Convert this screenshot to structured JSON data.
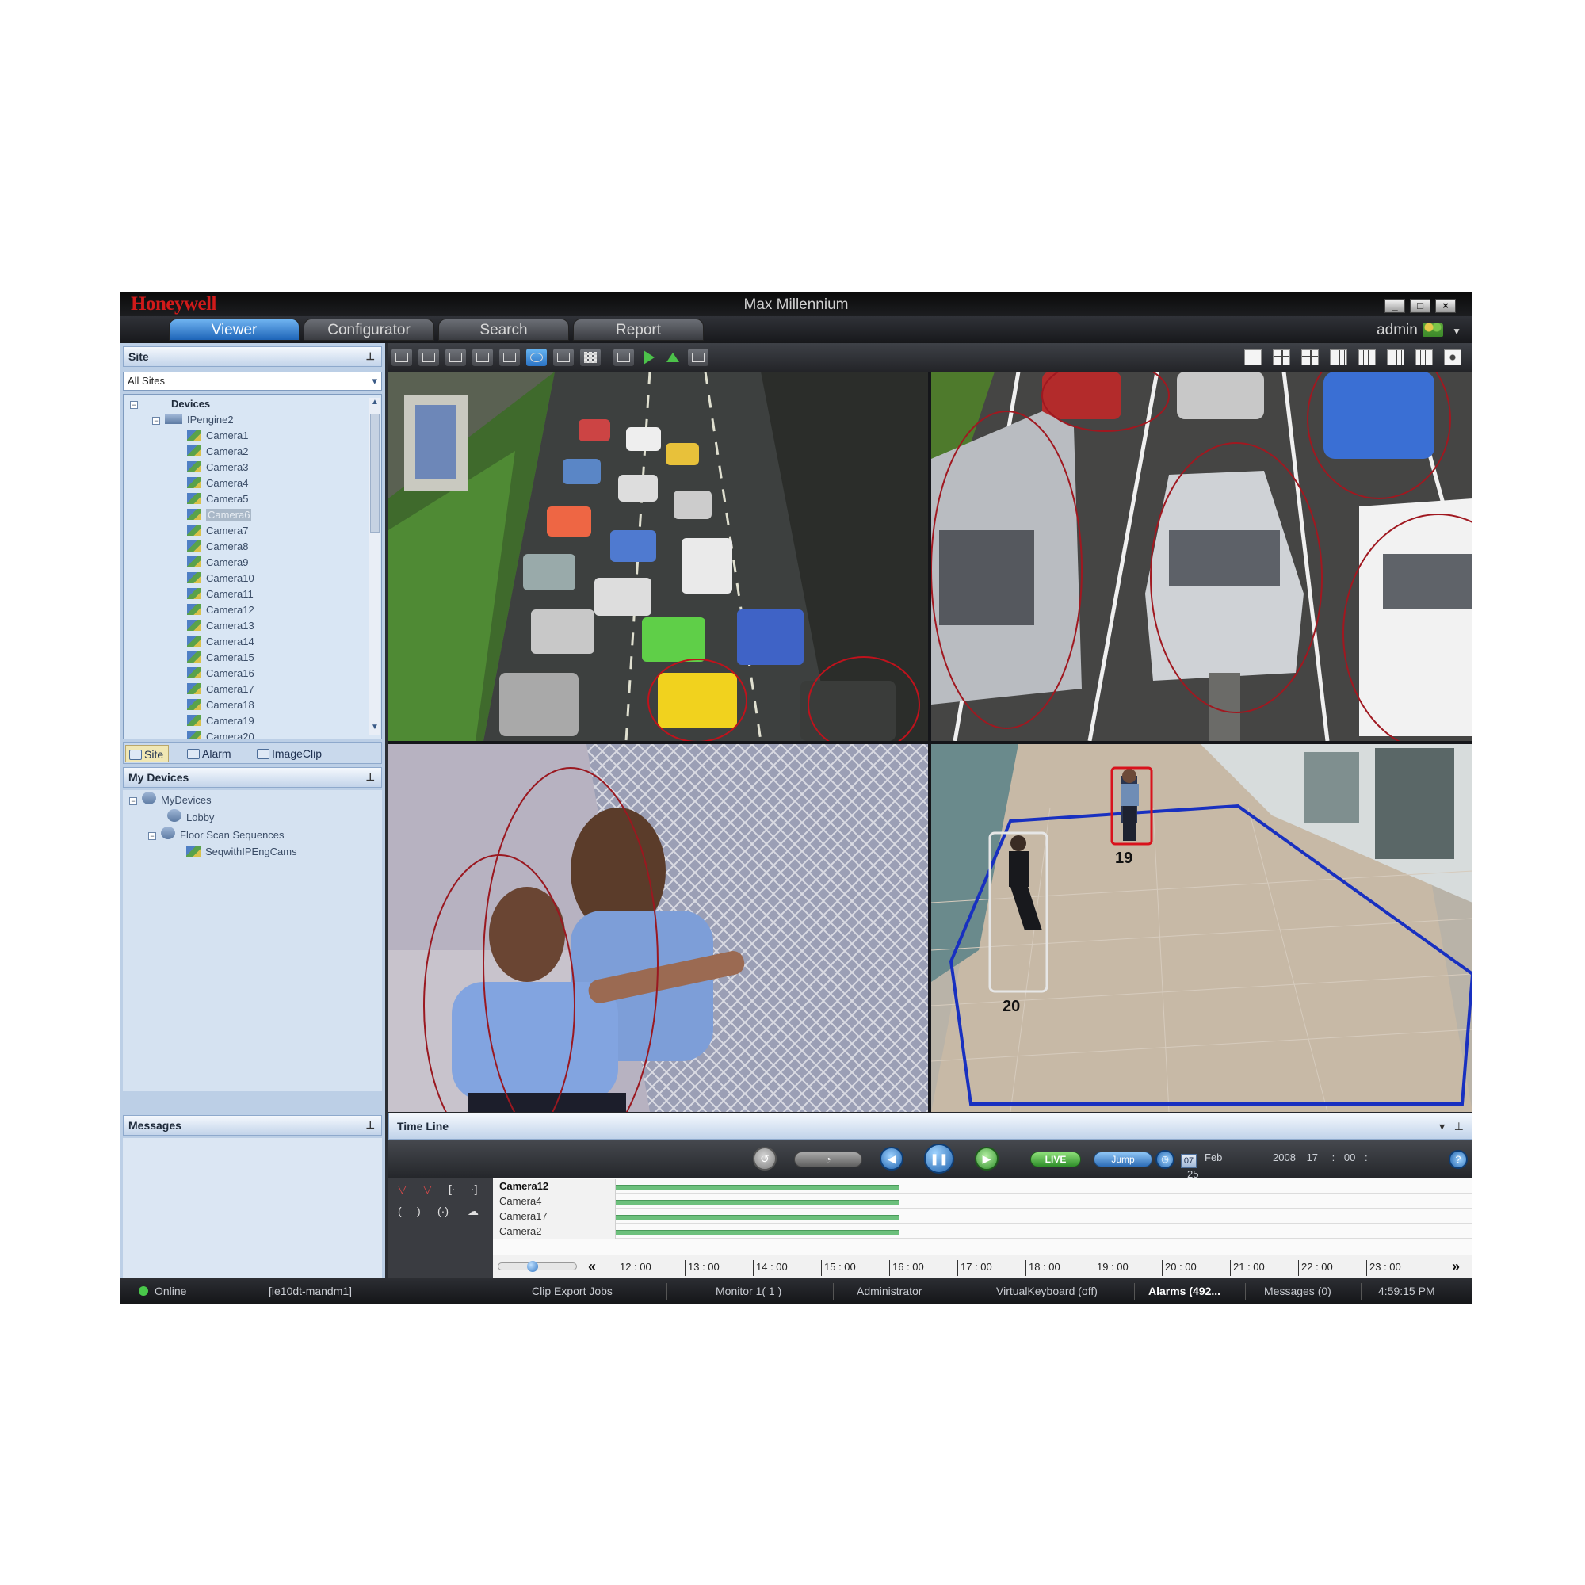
{
  "window": {
    "brand": "Honeywell",
    "title": "Max Millennium",
    "controls": [
      "minimize-icon",
      "maximize-icon",
      "close-icon"
    ]
  },
  "tabs": [
    {
      "label": "Viewer",
      "active": true
    },
    {
      "label": "Configurator",
      "active": false
    },
    {
      "label": "Search",
      "active": false
    },
    {
      "label": "Report",
      "active": false
    }
  ],
  "user": {
    "name": "admin",
    "icon": "users-icon"
  },
  "site_panel": {
    "title": "Site",
    "combo_value": "All Sites",
    "tree": {
      "root": "Devices",
      "server": "IPengine2",
      "cameras": [
        "Camera1",
        "Camera2",
        "Camera3",
        "Camera4",
        "Camera5",
        "Camera6",
        "Camera7",
        "Camera8",
        "Camera9",
        "Camera10",
        "Camera11",
        "Camera12",
        "Camera13",
        "Camera14",
        "Camera15",
        "Camera16",
        "Camera17",
        "Camera18",
        "Camera19",
        "Camera20"
      ],
      "selected_camera": "Camera6"
    },
    "tabs": [
      {
        "label": "Site",
        "active": true
      },
      {
        "label": "Alarm",
        "active": false
      },
      {
        "label": "ImageClip",
        "active": false
      }
    ]
  },
  "mydevices_panel": {
    "title": "My Devices",
    "items": [
      {
        "label": "MyDevices",
        "level": 0
      },
      {
        "label": "Lobby",
        "level": 1
      },
      {
        "label": "Floor Scan Sequences",
        "level": 1
      },
      {
        "label": "SeqwithIPEngCams",
        "level": 2
      }
    ]
  },
  "messages_panel": {
    "title": "Messages"
  },
  "video": {
    "tiles": [
      {
        "name": "video-tile-traffic",
        "scene": "traffic"
      },
      {
        "name": "video-tile-parking",
        "scene": "parked-cars"
      },
      {
        "name": "video-tile-fence",
        "scene": "guards-fence"
      },
      {
        "name": "video-tile-corridor",
        "scene": "corridor"
      }
    ],
    "corridor_ids": [
      "19",
      "20"
    ]
  },
  "timeline": {
    "title": "Time Line",
    "live_label": "LIVE",
    "jump_label": "Jump",
    "date": {
      "day": "07",
      "month": "Feb",
      "year": "2008",
      "hour": "17",
      "minute": "00",
      "second": "25"
    },
    "tracks": [
      {
        "name": "Camera12",
        "bold": true,
        "recorded": 0.33
      },
      {
        "name": "Camera4",
        "bold": false,
        "recorded": 0.33
      },
      {
        "name": "Camera17",
        "bold": false,
        "recorded": 0.33
      },
      {
        "name": "Camera2",
        "bold": false,
        "recorded": 0.33
      }
    ],
    "hours": [
      "12 : 00",
      "13 : 00",
      "14 : 00",
      "15 : 00",
      "16 : 00",
      "17 : 00",
      "18 : 00",
      "19 : 00",
      "20 : 00",
      "21 : 00",
      "22 : 00",
      "23 : 00"
    ],
    "nav_prev": "«",
    "nav_next": "»"
  },
  "statusbar": {
    "online": "Online",
    "host": "[ie10dt-mandm1]",
    "clip_jobs": "Clip Export Jobs",
    "monitor": "Monitor 1( 1 )",
    "role": "Administrator",
    "keyboard": "VirtualKeyboard (off)",
    "alarms": "Alarms (492...",
    "messages": "Messages (0)",
    "time": "4:59:15 PM"
  },
  "colors": {
    "brand_red": "#d01a1a",
    "tab_active": "#2a72c4",
    "panel_bg": "#bccfe6",
    "recorded_bar": "#6cc07c",
    "online_green": "#49c84a"
  }
}
